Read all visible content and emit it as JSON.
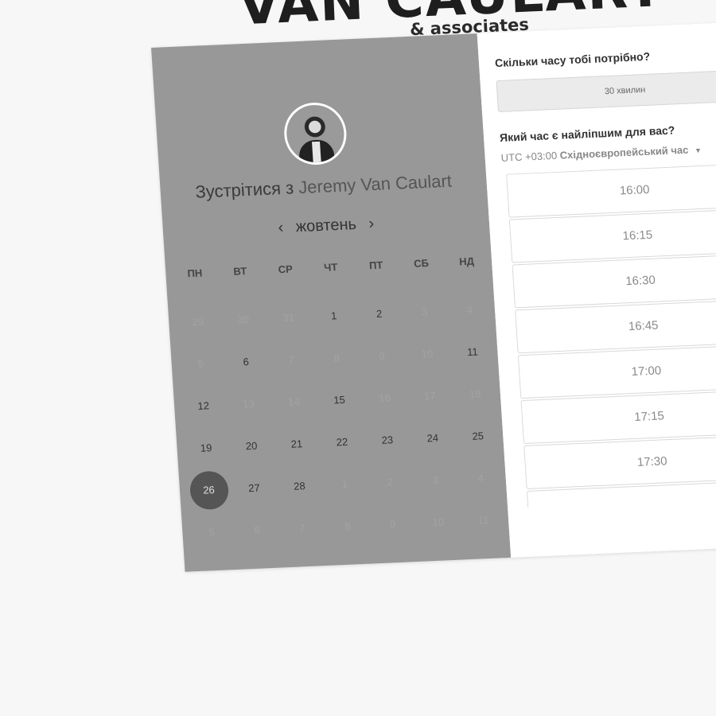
{
  "brand": {
    "title": "VAN CAULART",
    "subtitle": "& associates"
  },
  "calendar": {
    "heading_prefix": "Зустрітися з",
    "host_name": "Jeremy Van Caulart",
    "month": "жовтень",
    "prev_icon": "‹",
    "next_icon": "›",
    "weekdays": [
      "ПН",
      "ВТ",
      "СР",
      "ЧТ",
      "ПТ",
      "СБ",
      "НД"
    ],
    "weeks": [
      [
        "29",
        "30",
        "31",
        "1",
        "2",
        "3",
        "4"
      ],
      [
        "5",
        "6",
        "7",
        "8",
        "9",
        "10",
        "11"
      ],
      [
        "12",
        "13",
        "14",
        "15",
        "16",
        "17",
        "18"
      ],
      [
        "19",
        "20",
        "21",
        "22",
        "23",
        "24",
        "25"
      ],
      [
        "26",
        "27",
        "28",
        "1",
        "2",
        "3",
        "4"
      ],
      [
        "5",
        "6",
        "7",
        "8",
        "9",
        "10",
        "11"
      ]
    ],
    "available_days": [
      "1",
      "2",
      "6",
      "11",
      "12",
      "15",
      "19",
      "20",
      "21",
      "22",
      "23",
      "24",
      "25",
      "26",
      "27",
      "28"
    ],
    "selected_day": "26"
  },
  "booking": {
    "duration_question": "Скільки часу тобі потрібно?",
    "duration_value": "30 хвилин",
    "time_question": "Який час є найліпшим для вас?",
    "timezone_offset": "UTC +03:00",
    "timezone_name": "Східноєвропейський час",
    "slots": [
      "16:00",
      "16:15",
      "16:30",
      "16:45",
      "17:00",
      "17:15",
      "17:30",
      ""
    ]
  }
}
